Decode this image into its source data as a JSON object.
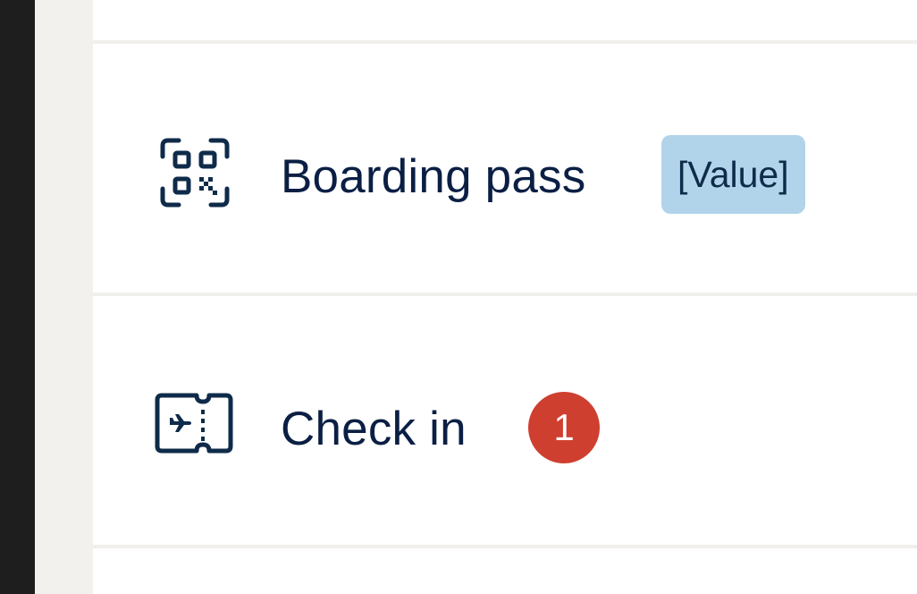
{
  "menu": {
    "items": [
      {
        "id": "boarding-pass",
        "icon": "qr-code-icon",
        "label": "Boarding pass",
        "tag": "[Value]"
      },
      {
        "id": "check-in",
        "icon": "ticket-plane-icon",
        "label": "Check in",
        "badge": "1"
      }
    ]
  },
  "colors": {
    "text": "#0b1f44",
    "icon": "#0f2b4a",
    "tag_background": "#b1d4ea",
    "badge_background": "#cf3f2f",
    "divider": "#f1efec",
    "gutter": "#f3f1ee",
    "edge": "#1e1e1e"
  }
}
